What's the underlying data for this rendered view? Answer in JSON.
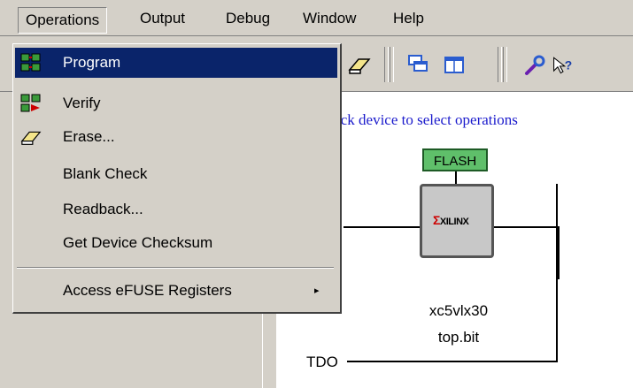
{
  "menubar": {
    "items": [
      "Operations",
      "Output",
      "Debug",
      "Window",
      "Help"
    ]
  },
  "operations_menu": {
    "items": [
      {
        "label": "Program",
        "icon": "program-icon",
        "selected": true
      },
      {
        "label": "Verify",
        "icon": "verify-icon",
        "selected": false
      },
      {
        "label": "Erase...",
        "icon": "eraser-icon",
        "selected": false
      },
      {
        "label": "Blank Check",
        "icon": null,
        "selected": false
      },
      {
        "label": "Readback...",
        "icon": null,
        "selected": false
      },
      {
        "label": "Get Device Checksum",
        "icon": null,
        "selected": false
      }
    ],
    "submenu_item": {
      "label": "Access eFUSE Registers",
      "arrow": "▸"
    }
  },
  "toolbar": {
    "icons": [
      "eraser-icon",
      "cascade-windows-icon",
      "tile-windows-icon",
      "wrench-icon",
      "help-cursor-icon"
    ]
  },
  "canvas": {
    "hint": "ick device to select operations",
    "flash_label": "FLASH",
    "chip_logo": "XILINX",
    "device_name": "xc5vlx30",
    "device_file": "top.bit",
    "tdo_label": "TDO"
  },
  "colors": {
    "menu_highlight": "#0a246a",
    "hint_text": "#1a1acc",
    "flash_fill": "#5fbf6a"
  }
}
